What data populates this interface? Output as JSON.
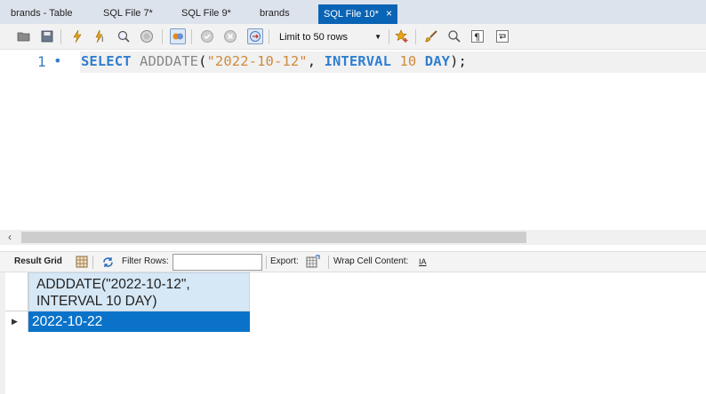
{
  "tabs": [
    {
      "label": "brands - Table"
    },
    {
      "label": "SQL File 7*"
    },
    {
      "label": "SQL File 9*"
    },
    {
      "label": "brands"
    },
    {
      "label": "SQL File 10*",
      "active": true,
      "close": "×"
    }
  ],
  "toolbar": {
    "limit_label": "Limit to 50 rows",
    "icons": [
      "folder-open-icon",
      "save-icon",
      "lightning-execute-icon",
      "lightning-cursor-icon",
      "magnifier-explain-icon",
      "stop-icon",
      "toggle-autocommit-icon",
      "commit-icon",
      "rollback-icon",
      "toggle-continue-icon",
      "bookmark-star-icon",
      "brush-beautify-icon",
      "search-icon",
      "invisible-chars-icon",
      "wrap-icon"
    ]
  },
  "editor": {
    "line_number": "1",
    "line_marker": "•",
    "tokens": {
      "select": "SELECT",
      "adddate": "ADDDATE",
      "open": "(",
      "date_str": "\"2022-10-12\"",
      "comma": ",",
      "interval": "INTERVAL",
      "amount": "10",
      "unit": "DAY",
      "close": ");"
    }
  },
  "result_toolbar": {
    "result_grid": "Result Grid",
    "filter_rows": "Filter Rows:",
    "filter_value": "",
    "export": "Export:",
    "wrap_cell": "Wrap Cell Content:",
    "wrap_icon_glyph": "IA"
  },
  "grid": {
    "header": "ADDDATE(\"2022-10-12\",\nINTERVAL 10 DAY)",
    "row_marker": "▶",
    "rows": [
      {
        "value": "2022-10-22"
      }
    ]
  },
  "colors": {
    "active_tab": "#0a64b5",
    "keyword": "#2f7fd0",
    "string": "#cf8a3a",
    "selected_cell": "#0a73c9",
    "header_bg": "#d6e7f5"
  }
}
